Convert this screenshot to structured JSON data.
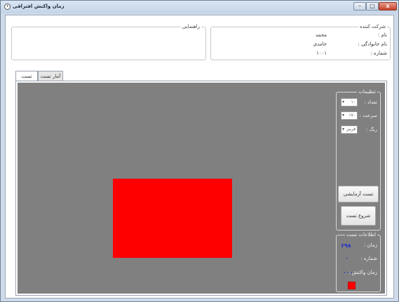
{
  "window": {
    "title": "زمان واکنش افتراقی",
    "controls": {
      "minimize": "–",
      "maximize": "□",
      "close": "x"
    }
  },
  "participant": {
    "group_label": "شرکت کننده",
    "first_name_label": "نام :",
    "first_name": "محمد",
    "last_name_label": "نام خانوادگی :",
    "last_name": "حامدی",
    "number_label": "شماره :",
    "number": "۱۰۰۱"
  },
  "guide": {
    "group_label": "راهنمایی"
  },
  "tabs": [
    {
      "label": "تست",
      "active": true
    },
    {
      "label": "آمار تست",
      "active": false
    }
  ],
  "settings": {
    "group_label": "تنظیمات",
    "count_label": "تعداد :",
    "count_value": "۱۰",
    "speed_label": "سرعت :",
    "speed_value": "۱۷۰",
    "color_label": "رنگ :",
    "color_value": "قرمز"
  },
  "buttons": {
    "trial_test": "تست آزمایشی",
    "start_test": "شروع تست"
  },
  "test_info": {
    "group_label": "اطلاعات تست",
    "time_label": "زمان :",
    "time_value": "۶۹۸",
    "number_label": "شماره :",
    "number_value": "۰",
    "reaction_label": "زمان واکنش :",
    "reaction_value": "۰۰۰"
  },
  "colors": {
    "stimulus": "#ff0000",
    "canvas": "#808080",
    "info_value": "#2430c8"
  }
}
